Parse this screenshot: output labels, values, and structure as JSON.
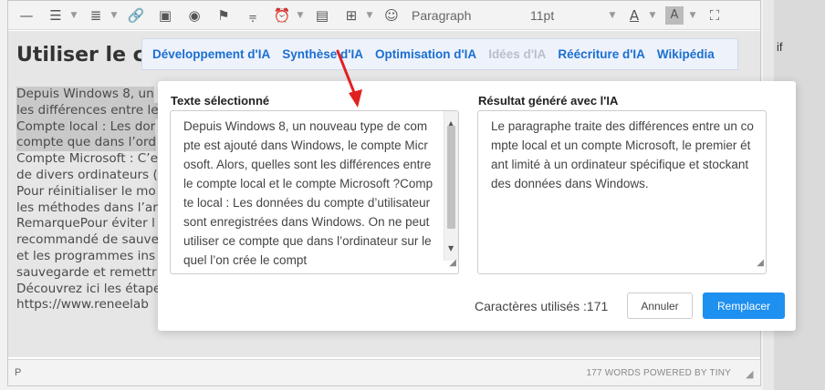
{
  "toolbar": {
    "paragraph_select": "Paragraph",
    "fontsize_select": "11pt"
  },
  "document": {
    "title_fragment": "Utiliser le co",
    "lines": [
      "Depuis Windows 8, un",
      "les différences entre le",
      "Compte local : Les dor",
      "compte que dans l’ord",
      "Compte Microsoft : C’e",
      "de divers ordinateurs (",
      "Pour réinitialiser le mo",
      "les méthodes dans l’ar",
      "RemarquePour éviter l",
      "recommandé de sauve",
      "et les programmes ins",
      "sauvegarde et remettr",
      "Découvrez ici les étape",
      "https://www.reneelab"
    ]
  },
  "status": {
    "path": "P",
    "words": "177 WORDS POWERED BY TINY"
  },
  "side_fragment": "if",
  "ai_menu": {
    "tabs": [
      {
        "label": "Développement d'IA",
        "enabled": true
      },
      {
        "label": "Synthèse d'IA",
        "enabled": true
      },
      {
        "label": "Optimisation d'IA",
        "enabled": true
      },
      {
        "label": "Idées d'IA",
        "enabled": false
      },
      {
        "label": "Réécriture d'IA",
        "enabled": true
      },
      {
        "label": "Wikipédia",
        "enabled": true
      }
    ]
  },
  "dialog": {
    "selected_label": "Texte sélectionné",
    "selected_text": "Depuis Windows 8, un nouveau type de compte est ajouté dans Windows, le compte Microsoft. Alors, quelles sont les différences entre le compte local et le compte Microsoft ?Compte local : Les données du compte d’utilisateur sont enregistrées dans Windows. On ne peut utiliser ce compte que dans l’ordinateur sur lequel l’on crée le compt",
    "result_label": "Résultat généré avec l'IA",
    "result_text": "Le paragraphe traite des différences entre un compte local et un compte Microsoft, le premier étant limité à un ordinateur spécifique et stockant des données dans Windows.",
    "chars_used": "Caractères utilisés :171",
    "cancel_label": "Annuler",
    "replace_label": "Remplacer"
  },
  "colors": {
    "accent": "#1e90f0",
    "tab_link": "#1a6fd1",
    "arrow": "#e02020"
  }
}
